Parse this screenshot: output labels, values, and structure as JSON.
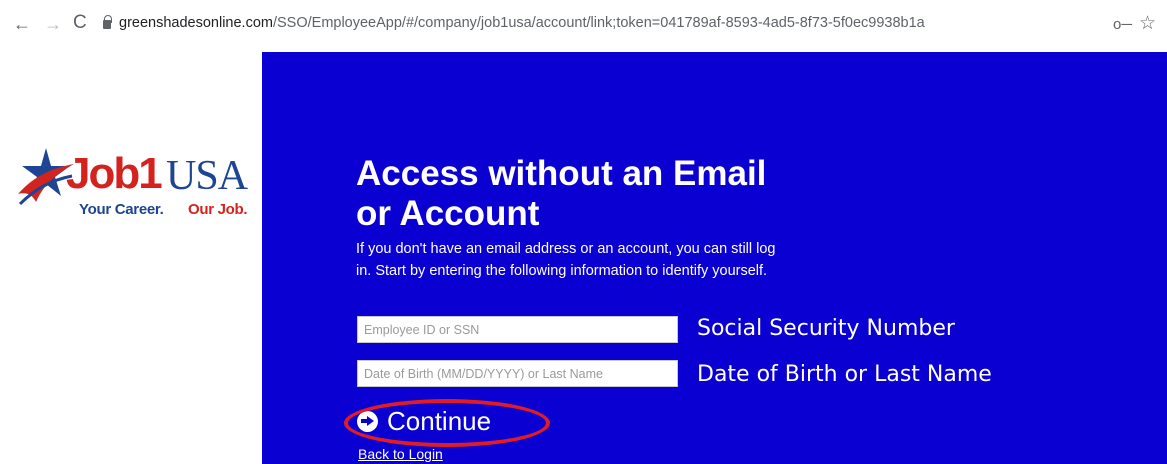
{
  "browser": {
    "back_icon": "←",
    "forward_icon": "→",
    "reload_icon": "C",
    "url_host": "greenshadesonline.com",
    "url_path": "/SSO/EmployeeApp/#/company/job1usa/account/link;token=041789af-8593-4ad5-8f73-5f0ec9938b1a",
    "key_icon": "o─",
    "star_icon": "☆"
  },
  "logo": {
    "brand_job": "Job",
    "brand_one": "1",
    "brand_usa": "USA",
    "tagline_a": "Your Career.",
    "tagline_b": "Our Job.",
    "colors": {
      "red": "#d3231f",
      "blue": "#1d4593"
    }
  },
  "panel": {
    "background": "#0b00d2",
    "title": "Access without an Email or Account",
    "description": "If you don't have an email address or an account, you can still log in. Start by entering the following information to identify yourself.",
    "fields": {
      "ssn": {
        "placeholder": "Employee ID or SSN",
        "value": "",
        "note": "Social Security Number"
      },
      "dob": {
        "placeholder": "Date of Birth (MM/DD/YYYY) or Last Name",
        "value": "",
        "note": "Date of Birth or Last Name"
      }
    },
    "continue_label": "Continue",
    "back_link": "Back to Login",
    "highlight_color": "#e31c24"
  }
}
